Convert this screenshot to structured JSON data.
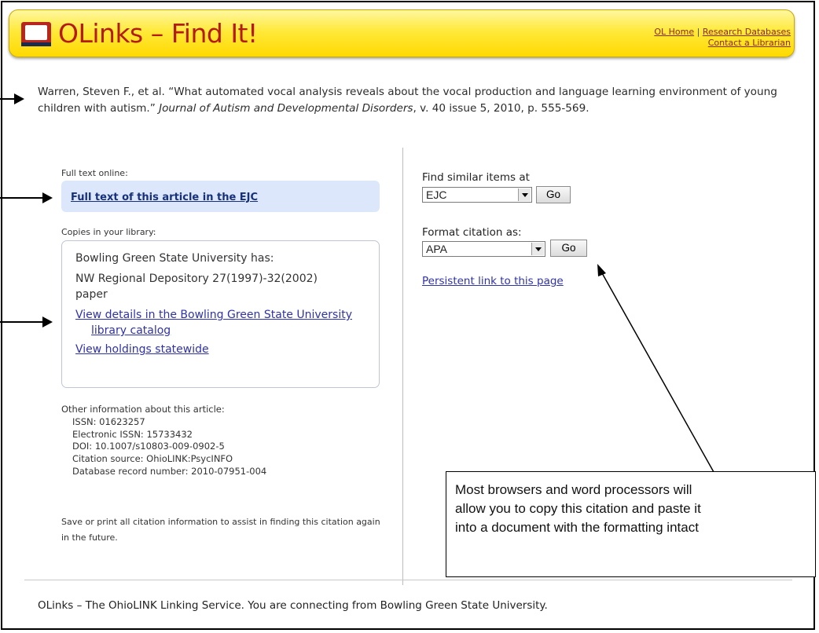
{
  "header": {
    "logo_icon": "book-icon",
    "title": "OLinks – Find It!",
    "links": {
      "home": "OL Home",
      "separator": "|",
      "databases": "Research Databases",
      "contact": "Contact a Librarian"
    }
  },
  "citation": {
    "authors": "Warren, Steven F., et al.",
    "article_title": "“What automated vocal analysis reveals about the vocal production and language learning environment of young children with autism.”",
    "journal": "Journal of Autism and Developmental Disorders",
    "details": ", v. 40 issue 5, 2010, p. 555-569."
  },
  "full_text": {
    "label": "Full text online:",
    "link": "Full text of this article in the EJC"
  },
  "copies": {
    "label": "Copies in your library:",
    "library": "Bowling Green State University has:",
    "holding": "NW Regional Depository 27(1997)-32(2002) paper",
    "catalog_link": "View details in the Bowling Green State University library catalog",
    "statewide_link": "View holdings statewide"
  },
  "other_info": {
    "label": "Other information about this article:",
    "issn": "ISSN: 01623257",
    "eissn": "Electronic ISSN: 15733432",
    "doi": "DOI: 10.1007/s10803-009-0902-5",
    "source": "Citation source: OhioLINK:PsycINFO",
    "record": "Database record number: 2010-07951-004"
  },
  "save_info": "Save or print all citation information to assist in finding this citation again in the future.",
  "similar": {
    "label": "Find similar items at",
    "selected": "EJC",
    "go": "Go"
  },
  "format": {
    "label": "Format citation as:",
    "selected": "APA",
    "go": "Go"
  },
  "persistent_link": "Persistent link to this page",
  "callout": {
    "line1": "Most browsers and word processors will",
    "line2": "allow you to copy this citation and paste it",
    "line3": "into a document with the formatting intact"
  },
  "footer": "OLinks – The OhioLINK Linking Service. You are connecting from Bowling Green State University."
}
